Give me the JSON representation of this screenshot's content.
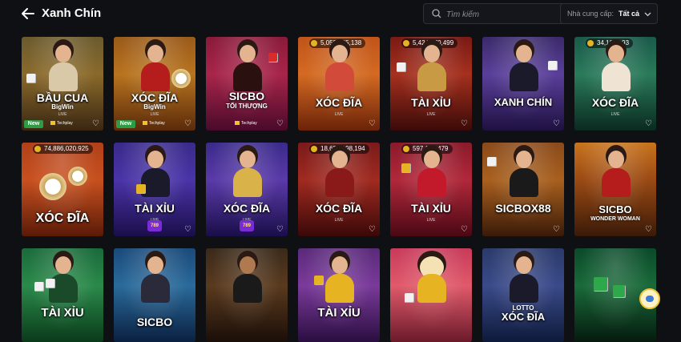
{
  "header": {
    "title": "Xanh Chín",
    "search_placeholder": "Tìm kiếm",
    "provider_label": "Nhà cung cấp:",
    "provider_value": "Tất cả"
  },
  "games": [
    {
      "id": "bau-cua",
      "name": "BẦU CUA",
      "sub": "BigWin",
      "new": true,
      "tech": "Techplay"
    },
    {
      "id": "xoc-dia-bigwin",
      "name": "XÓC ĐĨA",
      "sub": "BigWin",
      "new": true,
      "tech": "Techplay"
    },
    {
      "id": "sicbo-toi-thuong",
      "name": "SICBO",
      "sub": "TỐI THƯỢNG",
      "tech": "Techplay"
    },
    {
      "id": "xoc-dia-1",
      "name": "XÓC ĐĨA",
      "jackpot": "5,059,025,138"
    },
    {
      "id": "tai-xiu-1",
      "name": "TÀI XỈU",
      "jackpot": "5,424,670,499"
    },
    {
      "id": "xanh-chin",
      "name": "XANH CHÍN"
    },
    {
      "id": "xoc-dia-2",
      "name": "XÓC ĐĨA",
      "jackpot": "34,101,193"
    },
    {
      "id": "xoc-dia-3",
      "name": "XÓC ĐĨA",
      "jackpot": "74,886,020,925"
    },
    {
      "id": "tai-xiu-2",
      "name": "TÀI XỈU",
      "logo": "789"
    },
    {
      "id": "xoc-dia-4",
      "name": "XÓC ĐĨA",
      "logo": "789"
    },
    {
      "id": "xoc-dia-5",
      "name": "XÓC ĐĨA",
      "jackpot": "18,658,198,194"
    },
    {
      "id": "tai-xiu-3",
      "name": "TÀI XỈU",
      "jackpot": "597,160,479"
    },
    {
      "id": "sicbox88",
      "name": "SICBOX88"
    },
    {
      "id": "sicbo-wonder-woman",
      "name": "SICBO",
      "sub": "WONDER WOMAN"
    },
    {
      "id": "tai-xiu-4",
      "name": "TÀI XỈU"
    },
    {
      "id": "sicbo-2",
      "name": "SICBO"
    },
    {
      "id": "game-17",
      "name": ""
    },
    {
      "id": "tai-xiu-5",
      "name": "TÀI XỈU"
    },
    {
      "id": "game-19",
      "name": ""
    },
    {
      "id": "lotto-xoc-dia",
      "name": "XÓC ĐĨA",
      "sub": "LOTTO"
    },
    {
      "id": "game-21",
      "name": ""
    }
  ],
  "labels": {
    "live": "LIVE",
    "new": "New"
  },
  "icons": {
    "back": "arrow-left-icon",
    "search": "search-icon",
    "chevron": "chevron-down-icon",
    "heart": "heart-icon",
    "chat": "chat-icon"
  }
}
